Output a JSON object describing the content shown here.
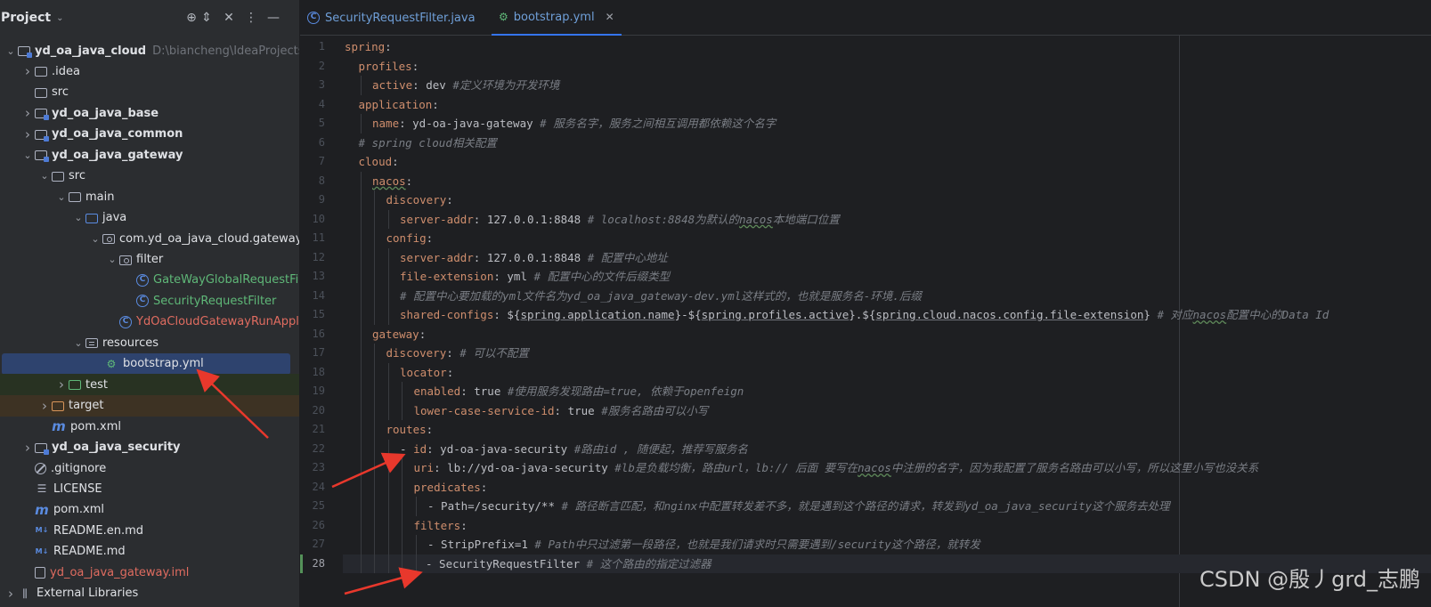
{
  "project": {
    "title": "Project",
    "header_icons": [
      "locate-icon",
      "expand-icon",
      "collapse-icon",
      "more-icon",
      "hide-icon"
    ],
    "tree": [
      {
        "level": 0,
        "chev": "open",
        "icon": "module",
        "label": "yd_oa_java_cloud",
        "hint": "D:\\biancheng\\IdeaProjects\\yd",
        "bold": true
      },
      {
        "level": 1,
        "chev": "closed",
        "icon": "folder",
        "label": ".idea"
      },
      {
        "level": 1,
        "chev": "none",
        "icon": "folder",
        "label": "src"
      },
      {
        "level": 1,
        "chev": "closed",
        "icon": "module",
        "label": "yd_oa_java_base",
        "bold": true
      },
      {
        "level": 1,
        "chev": "closed",
        "icon": "module",
        "label": "yd_oa_java_common",
        "bold": true
      },
      {
        "level": 1,
        "chev": "open",
        "icon": "module",
        "label": "yd_oa_java_gateway",
        "bold": true
      },
      {
        "level": 2,
        "chev": "open",
        "icon": "folder",
        "label": "src"
      },
      {
        "level": 3,
        "chev": "open",
        "icon": "folder",
        "label": "main"
      },
      {
        "level": 4,
        "chev": "open",
        "icon": "folder-blue",
        "label": "java"
      },
      {
        "level": 5,
        "chev": "open",
        "icon": "package",
        "label": "com.yd_oa_java_cloud.gateway"
      },
      {
        "level": 6,
        "chev": "open",
        "icon": "package",
        "label": "filter"
      },
      {
        "level": 7,
        "chev": "none",
        "icon": "class",
        "label": "GateWayGlobalRequestFilt",
        "color": "green"
      },
      {
        "level": 7,
        "chev": "none",
        "icon": "class",
        "label": "SecurityRequestFilter",
        "color": "green"
      },
      {
        "level": 6,
        "chev": "none",
        "icon": "class",
        "label": "YdOaCloudGatewayRunApplic",
        "color": "red"
      },
      {
        "level": 4,
        "chev": "open",
        "icon": "folder-res",
        "label": "resources"
      },
      {
        "level": 5,
        "chev": "none",
        "icon": "yml",
        "label": "bootstrap.yml",
        "selected": true
      },
      {
        "level": 3,
        "chev": "closed",
        "icon": "folder-green",
        "label": "test",
        "row": "test"
      },
      {
        "level": 2,
        "chev": "closed",
        "icon": "folder-orange",
        "label": "target",
        "row": "target"
      },
      {
        "level": 2,
        "chev": "none",
        "icon": "maven",
        "label": "pom.xml"
      },
      {
        "level": 1,
        "chev": "closed",
        "icon": "module",
        "label": "yd_oa_java_security",
        "bold": true
      },
      {
        "level": 1,
        "chev": "none",
        "icon": "ignore",
        "label": ".gitignore"
      },
      {
        "level": 1,
        "chev": "none",
        "icon": "text",
        "label": "LICENSE"
      },
      {
        "level": 1,
        "chev": "none",
        "icon": "maven",
        "label": "pom.xml"
      },
      {
        "level": 1,
        "chev": "none",
        "icon": "md",
        "label": "README.en.md"
      },
      {
        "level": 1,
        "chev": "none",
        "icon": "md",
        "label": "README.md"
      },
      {
        "level": 1,
        "chev": "none",
        "icon": "iml",
        "label": "yd_oa_java_gateway.iml",
        "color": "red"
      },
      {
        "level": 0,
        "chev": "closed",
        "icon": "lib",
        "label": "External Libraries"
      }
    ]
  },
  "tabs": [
    {
      "label": "SecurityRequestFilter.java",
      "icon": "class",
      "active": false
    },
    {
      "label": "bootstrap.yml",
      "icon": "yml",
      "active": true,
      "close": "✕"
    }
  ],
  "editor": {
    "current_line": 28,
    "lines": [
      [
        [
          "k",
          "spring"
        ],
        [
          "v",
          ":"
        ]
      ],
      [
        [
          "k",
          "profiles"
        ],
        [
          "v",
          ":"
        ]
      ],
      [
        [
          "k",
          "active"
        ],
        [
          "v",
          ": dev "
        ],
        [
          "c",
          "#定义环境为开发环境"
        ]
      ],
      [
        [
          "k",
          "application"
        ],
        [
          "v",
          ":"
        ]
      ],
      [
        [
          "k",
          "name"
        ],
        [
          "v",
          ": yd-oa-java-gateway "
        ],
        [
          "c",
          "# 服务名字，服务之间相互调用都依赖这个名字"
        ]
      ],
      [
        [
          "c",
          "# spring cloud相关配置"
        ]
      ],
      [
        [
          "k",
          "cloud"
        ],
        [
          "v",
          ":"
        ]
      ],
      [
        [
          "kt",
          "nacos"
        ],
        [
          "v",
          ":"
        ]
      ],
      [
        [
          "k",
          "discovery"
        ],
        [
          "v",
          ":"
        ]
      ],
      [
        [
          "k",
          "server-addr"
        ],
        [
          "v",
          ": 127.0.0.1:8848 "
        ],
        [
          "c",
          "# localhost:8848为默认的"
        ],
        [
          "ct",
          "nacos"
        ],
        [
          "c",
          "本地端口位置"
        ]
      ],
      [
        [
          "k",
          "config"
        ],
        [
          "v",
          ":"
        ]
      ],
      [
        [
          "k",
          "server-addr"
        ],
        [
          "v",
          ": 127.0.0.1:8848 "
        ],
        [
          "c",
          "# 配置中心地址"
        ]
      ],
      [
        [
          "k",
          "file-extension"
        ],
        [
          "v",
          ": yml "
        ],
        [
          "c",
          "# 配置中心的文件后缀类型"
        ]
      ],
      [
        [
          "c",
          "# 配置中心要加载的yml文件名为yd_oa_java_gateway-dev.yml这样式的，也就是服务名-环境.后缀"
        ]
      ],
      [
        [
          "k",
          "shared-configs"
        ],
        [
          "v",
          ": ${"
        ],
        [
          "p",
          "spring.application.name"
        ],
        [
          "v",
          "}-${"
        ],
        [
          "p",
          "spring.profiles.active"
        ],
        [
          "v",
          "}.${"
        ],
        [
          "p",
          "spring.cloud.nacos.config.file-extension"
        ],
        [
          "v",
          "} "
        ],
        [
          "c",
          "# 对应"
        ],
        [
          "ct",
          "nacos"
        ],
        [
          "c",
          "配置中心的Data Id"
        ]
      ],
      [
        [
          "k",
          "gateway"
        ],
        [
          "v",
          ":"
        ]
      ],
      [
        [
          "k",
          "discovery"
        ],
        [
          "v",
          ": "
        ],
        [
          "c",
          "# 可以不配置"
        ]
      ],
      [
        [
          "k",
          "locator"
        ],
        [
          "v",
          ":"
        ]
      ],
      [
        [
          "k",
          "enabled"
        ],
        [
          "v",
          ": true "
        ],
        [
          "c",
          "#使用服务发现路由=true, 依赖于openfeign"
        ]
      ],
      [
        [
          "k",
          "lower-case-service-id"
        ],
        [
          "v",
          ": true "
        ],
        [
          "c",
          "#服务名路由可以小写"
        ]
      ],
      [
        [
          "k",
          "routes"
        ],
        [
          "v",
          ":"
        ]
      ],
      [
        [
          "v",
          "- "
        ],
        [
          "k",
          "id"
        ],
        [
          "v",
          ": yd-oa-java-security "
        ],
        [
          "c",
          "#路由id , 随便起，推荐写服务名"
        ]
      ],
      [
        [
          "k",
          "uri"
        ],
        [
          "v",
          ": lb://yd-oa-java-security "
        ],
        [
          "c",
          "#lb是负载均衡，路由url，lb:// 后面 要写在"
        ],
        [
          "ct",
          "nacos"
        ],
        [
          "c",
          "中注册的名字，因为我配置了服务名路由可以小写，所以这里小写也没关系"
        ]
      ],
      [
        [
          "k",
          "predicates"
        ],
        [
          "v",
          ":"
        ]
      ],
      [
        [
          "v",
          "- Path=/security/** "
        ],
        [
          "c",
          "# 路径断言匹配，和nginx中配置转发差不多，就是遇到这个路径的请求，转发到yd_oa_java_security这个服务去处理"
        ]
      ],
      [
        [
          "k",
          "filters"
        ],
        [
          "v",
          ":"
        ]
      ],
      [
        [
          "v",
          "- StripPrefix=1 "
        ],
        [
          "c",
          "# Path中只过滤第一段路径，也就是我们请求时只需要遇到/security这个路径，就转发"
        ]
      ],
      [
        [
          "v",
          "- SecurityRequestFilter "
        ],
        [
          "c",
          "# 这个路由的指定过滤器"
        ]
      ]
    ],
    "indents": [
      0,
      1,
      2,
      1,
      2,
      1,
      1,
      2,
      3,
      4,
      3,
      4,
      4,
      4,
      4,
      2,
      3,
      4,
      5,
      5,
      3,
      4,
      5,
      5,
      6,
      5,
      6,
      6
    ]
  },
  "watermark": "CSDN @殷丿grd_志鹏"
}
